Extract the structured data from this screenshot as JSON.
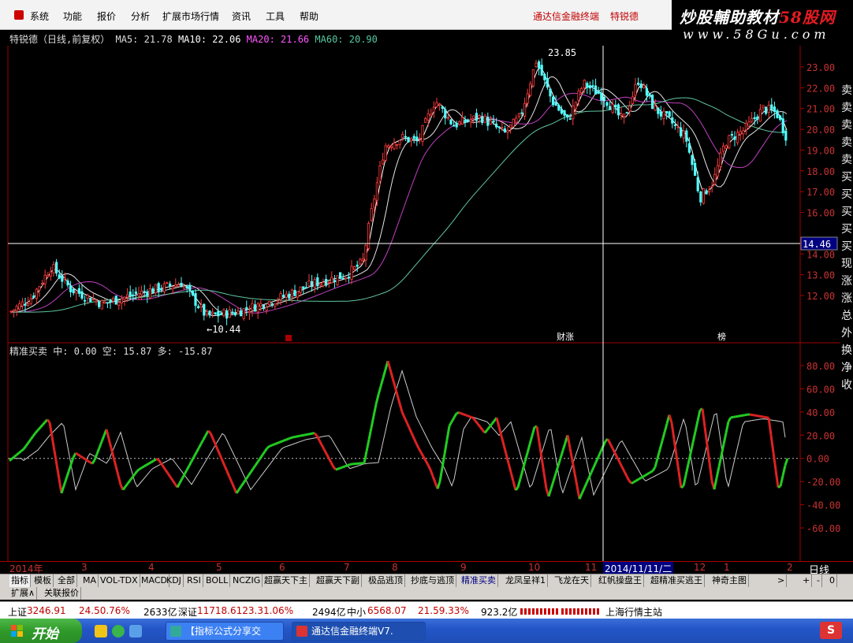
{
  "menu": {
    "items": [
      "系统",
      "功能",
      "报价",
      "分析",
      "扩展市场行情",
      "资讯",
      "工具",
      "帮助"
    ],
    "broker": "通达信金融终端",
    "stock_name": "特锐德"
  },
  "watermark": {
    "line1_a": "炒股輔助教材",
    "line1_b": "58股网",
    "line2": "www.58Gu.com"
  },
  "price_panel": {
    "title": "特锐德（日线,前复权）",
    "ma5": "MA5: 21.78",
    "ma10": "MA10: 22.06",
    "ma20": "MA20: 21.66",
    "ma60": "MA60: 20.90",
    "high_label": "23.85",
    "low_label": "←10.44",
    "cursor_price": "14.46",
    "event_labels": [
      "财涨",
      "榜"
    ],
    "y_ticks": [
      "23.00",
      "22.00",
      "21.00",
      "20.00",
      "19.00",
      "18.00",
      "17.00",
      "16.00",
      "14.00",
      "13.00",
      "12.00"
    ]
  },
  "indicator_panel": {
    "title": "精准买卖",
    "mid": "中: 0.00",
    "kong": "空: 15.87",
    "duo": "多: -15.87",
    "y_ticks": [
      "80.00",
      "60.00",
      "40.00",
      "20.00",
      "0.00",
      "-20.00",
      "-40.00",
      "-60.00"
    ]
  },
  "side_labels": [
    "卖",
    "卖",
    "卖",
    "卖",
    "卖",
    "买",
    "买",
    "买",
    "买",
    "买",
    "现",
    "涨",
    "涨",
    "总",
    "外",
    "换",
    "净",
    "收"
  ],
  "date_axis": {
    "labels": [
      "2014年",
      "3",
      "4",
      "5",
      "6",
      "7",
      "8",
      "9",
      "10",
      "11",
      "2014/11/11/二",
      "12",
      "1",
      "2"
    ],
    "period": "日线"
  },
  "tabs": [
    "指标",
    "模板",
    "全部",
    "MA",
    "VOL-TDX",
    "MACD",
    "KDJ",
    "RSI",
    "BOLL",
    "NCZIG",
    "超赢天下主",
    "超赢天下副",
    "极品逃顶",
    "抄底与逃顶",
    "精准买卖",
    "龙凤呈祥1",
    "飞龙在天",
    "红帆操盘王",
    "超精准买逃王",
    "神奇主图"
  ],
  "tab_controls": [
    ">",
    "+",
    "-",
    "0"
  ],
  "tabs2": [
    "扩展∧",
    "关联报价"
  ],
  "status": {
    "sh_label": "上证",
    "sh_value": "3246.91",
    "sh_change": "24.50.76%",
    "sh_vol": "2633亿",
    "sz_label": "深证",
    "sz_value": "11718.6123.31.06%",
    "sz_vol": "2494亿",
    "zx_label": "中小",
    "zx_value": "6568.07",
    "zx_change": "21.59.33%",
    "zx_vol": "923.2亿",
    "server": "上海行情主站"
  },
  "taskbar": {
    "start": "开始",
    "tasks": [
      "【指标公式分享交",
      "通达信金融终端V7."
    ],
    "tray": "S"
  },
  "chart_data": {
    "type": "candlestick",
    "price_range": [
      10.0,
      23.9
    ],
    "indicator_range": [
      -80,
      90
    ],
    "cursor_price": 14.46
  }
}
